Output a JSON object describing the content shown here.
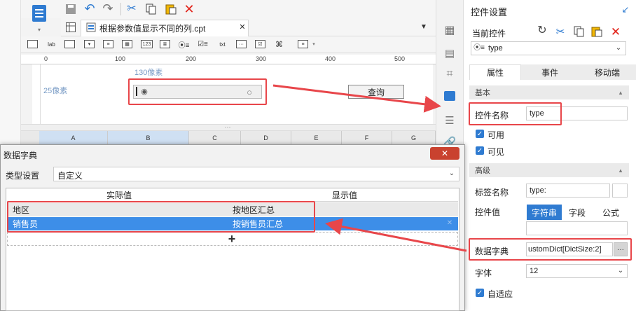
{
  "toolbar": {
    "icons": [
      "new-report-icon",
      "save-icon",
      "undo-icon",
      "redo-icon",
      "cut-icon",
      "copy-icon",
      "paste-icon",
      "delete-icon"
    ]
  },
  "tab": {
    "title": "根据参数值显示不同的列.cpt"
  },
  "ruler": {
    "ticks": [
      "0",
      "100",
      "200",
      "300",
      "400",
      "500"
    ]
  },
  "canvas": {
    "width_label": "130像素",
    "height_label": "25像素",
    "query_button": "查询"
  },
  "sheet": {
    "columns": [
      "A",
      "B",
      "C",
      "D",
      "E",
      "F",
      "G"
    ]
  },
  "dialog": {
    "title": "数据字典",
    "close_label": "✕",
    "type_label": "类型设置",
    "type_value": "自定义",
    "col_actual": "实际值",
    "col_display": "显示值",
    "rows": [
      {
        "actual": "地区",
        "display": "按地区汇总"
      },
      {
        "actual": "销售员",
        "display": "按销售员汇总"
      }
    ],
    "add_label": "+"
  },
  "panel": {
    "title": "控件设置",
    "current_widget_label": "当前控件",
    "current_widget_value": "type",
    "tabs": [
      "属性",
      "事件",
      "移动端"
    ],
    "section_basic": "基本",
    "widget_name_label": "控件名称",
    "widget_name_value": "type",
    "enabled_label": "可用",
    "visible_label": "可见",
    "section_advanced": "高级",
    "tag_name_label": "标签名称",
    "tag_name_value": "type:",
    "widget_value_label": "控件值",
    "value_types": [
      "字符串",
      "字段",
      "公式"
    ],
    "dict_label": "数据字典",
    "dict_value": "ustomDict[DictSize:2]",
    "dict_more": "···",
    "font_label": "字体",
    "font_value": "12",
    "autofit_label": "自适应"
  },
  "colors": {
    "accent": "#2f7bd1",
    "highlight_box": "#e8464a",
    "selected_row": "#3d8ee8"
  }
}
